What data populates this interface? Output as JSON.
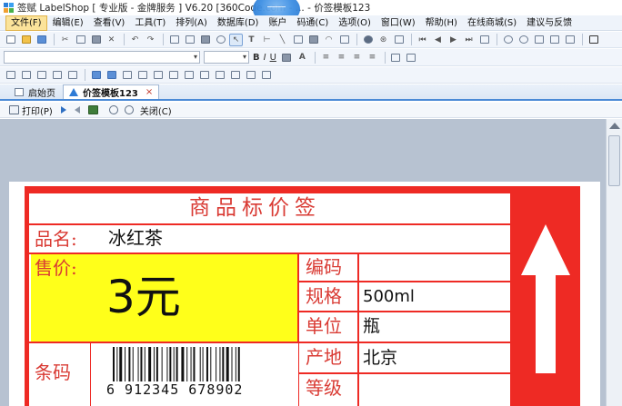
{
  "window": {
    "title": "签赋 LabelShop [ 专业版 - 金牌服务 ]  V6.20  [360Code.com - ... - 价签模板123"
  },
  "menu": {
    "items": [
      {
        "label": "文件(F)"
      },
      {
        "label": "编辑(E)"
      },
      {
        "label": "查看(V)"
      },
      {
        "label": "工具(T)"
      },
      {
        "label": "排列(A)"
      },
      {
        "label": "数据库(D)"
      },
      {
        "label": "账户"
      },
      {
        "label": "码通(C)"
      },
      {
        "label": "选项(O)"
      },
      {
        "label": "窗口(W)"
      },
      {
        "label": "帮助(H)"
      },
      {
        "label": "在线商城(S)"
      },
      {
        "label": "建议与反馈"
      }
    ]
  },
  "tabs": [
    {
      "label": "启始页",
      "icon": "page-icon"
    },
    {
      "label": "价签模板123",
      "icon": "template-icon",
      "close": "×"
    }
  ],
  "preview_toolbar": {
    "print": "打印(P)",
    "close": "关闭(C)"
  },
  "label": {
    "header": "商品标价签",
    "name_label": "品名:",
    "name_value": "冰红茶",
    "price_label": "售价:",
    "price_value": "3元",
    "barcode_label": "条码",
    "barcode_digits": "6 912345 678902",
    "fields": [
      {
        "key": "编码",
        "value": ""
      },
      {
        "key": "规格",
        "value": "500ml"
      },
      {
        "key": "单位",
        "value": "瓶"
      },
      {
        "key": "产地",
        "value": "北京"
      },
      {
        "key": "等级",
        "value": ""
      }
    ],
    "colors": {
      "red": "#ee2a24",
      "yellow": "#ffff1a",
      "text_red": "#d93a33"
    }
  },
  "toolbar_format": {
    "bold": "B",
    "italic": "I",
    "underline": "U"
  }
}
